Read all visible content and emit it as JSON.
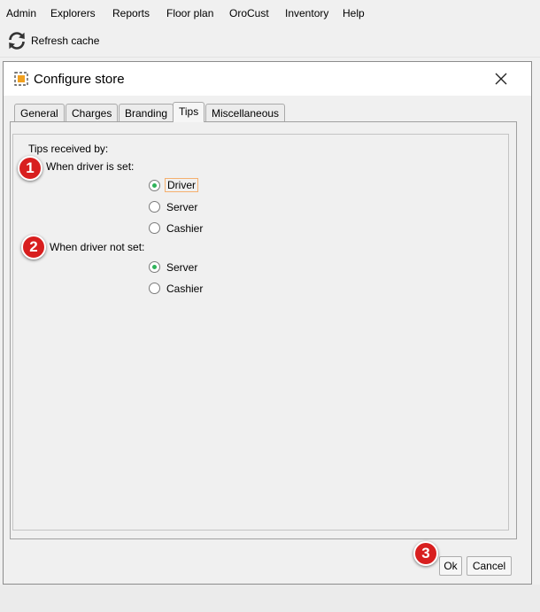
{
  "menubar": {
    "items": [
      {
        "label": "Admin"
      },
      {
        "label": "Explorers"
      },
      {
        "label": "Reports"
      },
      {
        "label": "Floor plan"
      },
      {
        "label": "OroCust"
      },
      {
        "label": "Inventory"
      },
      {
        "label": "Help"
      }
    ]
  },
  "toolbar": {
    "refresh_label": "Refresh cache",
    "refresh_icon": "refresh-icon"
  },
  "dialog": {
    "title": "Configure store",
    "tabs": [
      {
        "label": "General"
      },
      {
        "label": "Charges"
      },
      {
        "label": "Branding"
      },
      {
        "label": "Tips",
        "active": true
      },
      {
        "label": "Miscellaneous"
      }
    ],
    "tips": {
      "heading": "Tips received by:",
      "driver_set": {
        "label": "When driver is set:",
        "options": [
          {
            "label": "Driver",
            "checked": true
          },
          {
            "label": "Server",
            "checked": false
          },
          {
            "label": "Cashier",
            "checked": false
          }
        ]
      },
      "driver_not_set": {
        "label": "When driver not set:",
        "options": [
          {
            "label": "Server",
            "checked": true
          },
          {
            "label": "Cashier",
            "checked": false
          }
        ]
      }
    },
    "buttons": {
      "ok": "Ok",
      "cancel": "Cancel"
    },
    "markers": [
      "1",
      "2",
      "3"
    ]
  },
  "colors": {
    "marker": "#d81f1f",
    "radio_checked": "#2fb35a",
    "focus_outline": "#f5b06f"
  }
}
